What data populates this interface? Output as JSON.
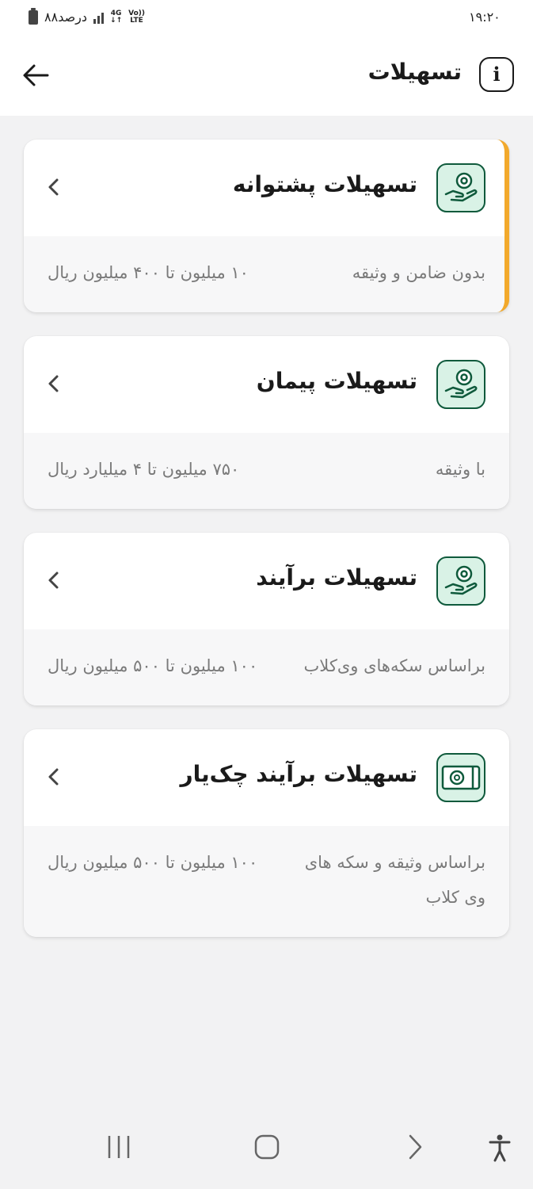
{
  "status_bar": {
    "time": "۱۹:۲۰",
    "battery": "۸۸درصد",
    "network_top": "4G",
    "network_bottom": "LTE",
    "volte": "Vo))"
  },
  "header": {
    "title": "تسهیلات"
  },
  "cards": [
    {
      "title": "تسهیلات پشتوانه",
      "condition": "بدون ضامن و وثیقه",
      "range": "۱۰ میلیون تا ۴۰۰ میلیون ریال",
      "icon": "hand-coin-icon",
      "active": true
    },
    {
      "title": "تسهیلات پیمان",
      "condition": "با وثیقه",
      "range": "۷۵۰ میلیون تا ۴ میلیارد ریال",
      "icon": "hand-coin-icon"
    },
    {
      "title": "تسهیلات برآیند",
      "condition": "براساس سکه‌های وی‌کلاب",
      "range": "۱۰۰ میلیون تا ۵۰۰ میلیون ریال",
      "icon": "hand-coin-icon"
    },
    {
      "title": "تسهیلات برآیند چک‌یار",
      "condition": "براساس وثیقه و سکه های وی کلاب",
      "range": "۱۰۰ میلیون تا ۵۰۰ میلیون ریال",
      "icon": "cheque-icon"
    }
  ],
  "colors": {
    "accent": "#f2a92c",
    "icon_green": "#0f5a3c",
    "icon_bg": "#d9f2e6"
  }
}
